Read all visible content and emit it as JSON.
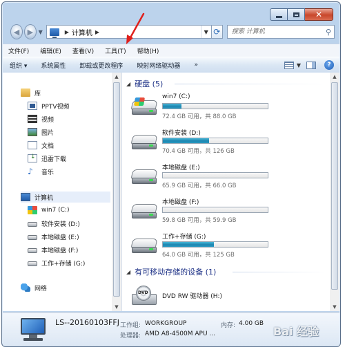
{
  "window": {
    "accent": "#bcd3ec",
    "close_color": "#c9472b"
  },
  "address": {
    "path_label": "计算机",
    "search_placeholder": "搜索 计算机"
  },
  "menu": [
    {
      "label": "文件(F)"
    },
    {
      "label": "编辑(E)"
    },
    {
      "label": "查看(V)"
    },
    {
      "label": "工具(T)"
    },
    {
      "label": "帮助(H)"
    }
  ],
  "commands": [
    {
      "label": "组织 ▾"
    },
    {
      "label": "系统属性"
    },
    {
      "label": "卸载或更改程序"
    },
    {
      "label": "映射网络驱动器"
    },
    {
      "label": "»"
    }
  ],
  "nav": {
    "libraries": {
      "label": "库"
    },
    "library_items": [
      {
        "label": "PPTV视频",
        "icon": "video-icon"
      },
      {
        "label": "视频",
        "icon": "film-icon"
      },
      {
        "label": "图片",
        "icon": "picture-icon"
      },
      {
        "label": "文档",
        "icon": "document-icon"
      },
      {
        "label": "迅雷下载",
        "icon": "download-icon"
      },
      {
        "label": "音乐",
        "icon": "music-icon"
      }
    ],
    "computer": {
      "label": "计算机"
    },
    "computer_items": [
      {
        "label": "win7 (C:)",
        "icon": "windows-drive-icon"
      },
      {
        "label": "软件安装 (D:)",
        "icon": "drive-icon"
      },
      {
        "label": "本地磁盘 (E:)",
        "icon": "drive-icon"
      },
      {
        "label": "本地磁盘 (F:)",
        "icon": "drive-icon"
      },
      {
        "label": "工作+存储 (G:)",
        "icon": "drive-icon"
      }
    ],
    "network": {
      "label": "网络"
    }
  },
  "groups": {
    "hdd": {
      "title": "硬盘 (5)"
    },
    "removable": {
      "title": "有可移动存储的设备 (1)"
    }
  },
  "drives": [
    {
      "name": "win7 (C:)",
      "free": "72.4 GB 可用，共 88.0 GB",
      "used_fraction": 0.18
    },
    {
      "name": "软件安装 (D:)",
      "free": "70.4 GB 可用，共 126 GB",
      "used_fraction": 0.44
    },
    {
      "name": "本地磁盘 (E:)",
      "free": "65.9 GB 可用，共 66.0 GB",
      "used_fraction": 0.0
    },
    {
      "name": "本地磁盘 (F:)",
      "free": "59.8 GB 可用，共 59.9 GB",
      "used_fraction": 0.0
    },
    {
      "name": "工作+存储 (G:)",
      "free": "64.0 GB 可用，共 125 GB",
      "used_fraction": 0.49
    }
  ],
  "dvd": {
    "name": "DVD RW 驱动器 (H:)",
    "icon_label": "DVD"
  },
  "details": {
    "computer_name": "LS--20160103FFJ",
    "workgroup_label": "工作组:",
    "workgroup_value": "WORKGROUP",
    "memory_label": "内存:",
    "memory_value": "4.00 GB",
    "cpu_label": "处理器:",
    "cpu_value": "AMD A8-4500M APU ..."
  },
  "watermark": "Bai 经验"
}
